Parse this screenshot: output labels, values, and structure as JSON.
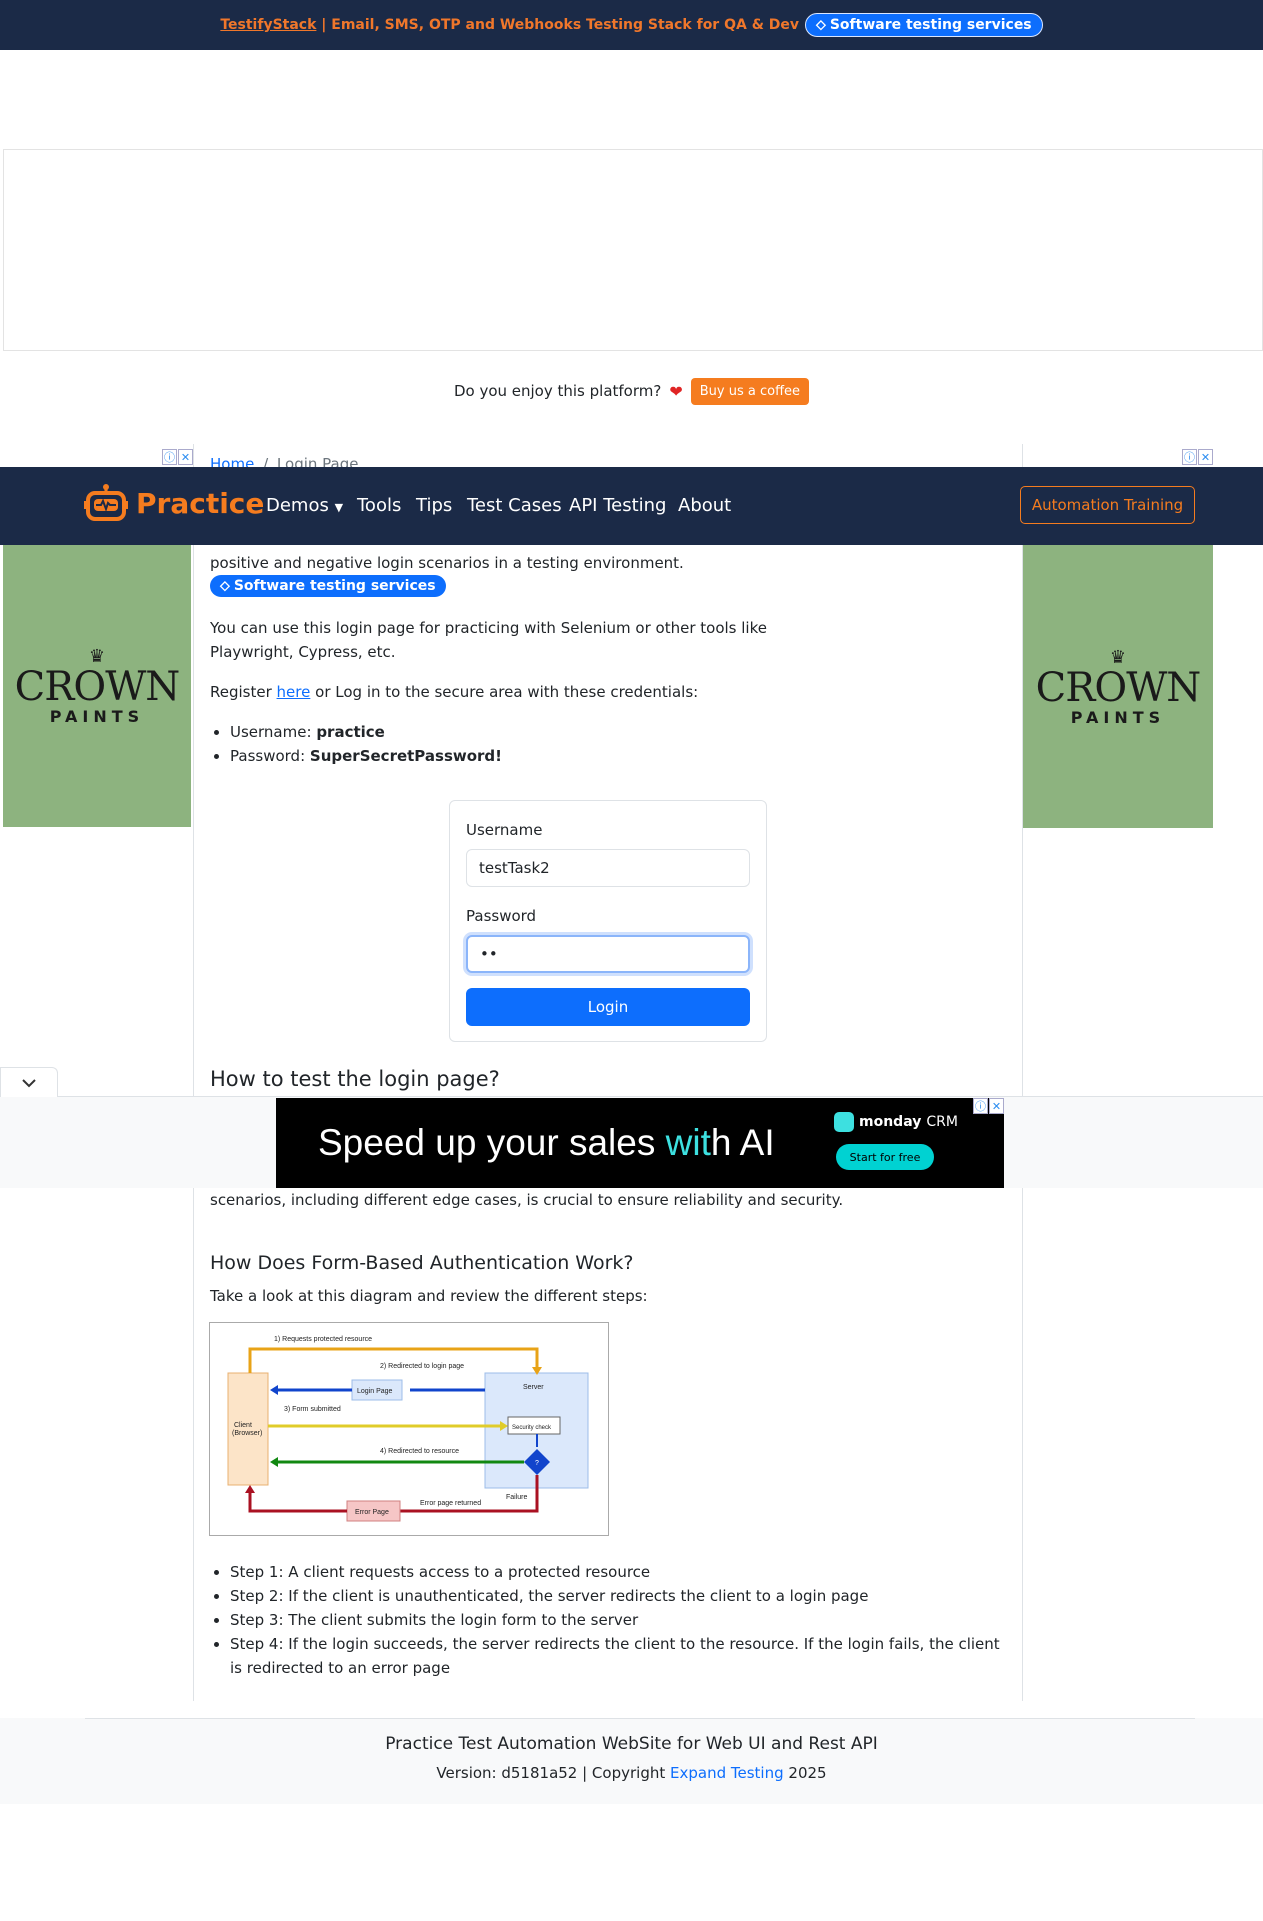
{
  "top_banner": {
    "brand_link": "TestifyStack",
    "promo_rest": "| Email, SMS, OTP and Webhooks Testing Stack for QA & Dev",
    "services_badge": "Software testing services"
  },
  "coffee": {
    "question": "Do you enjoy this platform?",
    "button": "Buy us a coffee"
  },
  "side_ads": {
    "brand": "CROWN",
    "subtitle": "PAINTS"
  },
  "breadcrumb": {
    "home": "Home",
    "separator": "/",
    "current": "Login Page"
  },
  "navbar": {
    "brand": "Practice",
    "links": [
      "Demos",
      "Tools",
      "Tips",
      "Test Cases",
      "API Testing",
      "About"
    ],
    "training_button": "Automation Training"
  },
  "intro": {
    "line2": "positive and negative login scenarios in a testing environment.",
    "services_badge": "Software testing services",
    "practice_text": "You can use this login page for practicing with Selenium or other tools like Playwright, Cypress, etc.",
    "register_prefix": "Register",
    "register_link": "here",
    "register_suffix": "or Log in to the secure area with these credentials:",
    "username_label": "Username:",
    "username_value": "practice",
    "password_label": "Password:",
    "password_value": "SuperSecretPassword!"
  },
  "login_form": {
    "username_label": "Username",
    "username_value": "testTask2",
    "password_label": "Password",
    "password_value": "••",
    "login_button": "Login"
  },
  "how_to_test": {
    "heading": "How to test the login page?",
    "text_tail": "scenarios, including different edge cases, is crucial to ensure reliability and security."
  },
  "bottom_ad": {
    "headline_pre": "Speed up your sales ",
    "headline_highlight": "wit",
    "headline_post": "h AI",
    "brand": "monday",
    "brand_suffix": "CRM",
    "cta": "Start for free"
  },
  "form_auth": {
    "heading": "How Does Form-Based Authentication Work?",
    "intro": "Take a look at this diagram and review the different steps:",
    "steps": [
      "Step 1: A client requests access to a protected resource",
      "Step 2: If the client is unauthenticated, the server redirects the client to a login page",
      "Step 3: The client submits the login form to the server",
      "Step 4: If the login succeeds, the server redirects the client to the resource. If the login fails, the client is redirected to an error page"
    ]
  },
  "diagram": {
    "labels": {
      "step1": "1) Requests protected resource",
      "step2": "2) Redirected to login page",
      "login_page": "Login Page",
      "server": "Server",
      "step3": "3) Form submitted",
      "client": "Client",
      "client_sub": "(Browser)",
      "security_check": "Security check",
      "step4": "4) Redirected to resource",
      "decision": "?",
      "error_page": "Error Page",
      "error_returned": "Error page returned",
      "failure": "Failure"
    },
    "colors": {
      "orange": "#e8a317",
      "blue": "#1144cc",
      "yellow": "#e0cc2a",
      "green": "#118811",
      "red": "#aa1122"
    }
  },
  "footer": {
    "title": "Practice Test Automation WebSite for Web UI and Rest API",
    "version_prefix": "Version: d5181a52 | Copyright",
    "company_link": "Expand Testing",
    "year": "2025"
  },
  "colors": {
    "navy": "#1b2a47",
    "brand_orange": "#f57c1f",
    "primary_blue": "#0d6efd",
    "ad_green": "#8db37f"
  }
}
